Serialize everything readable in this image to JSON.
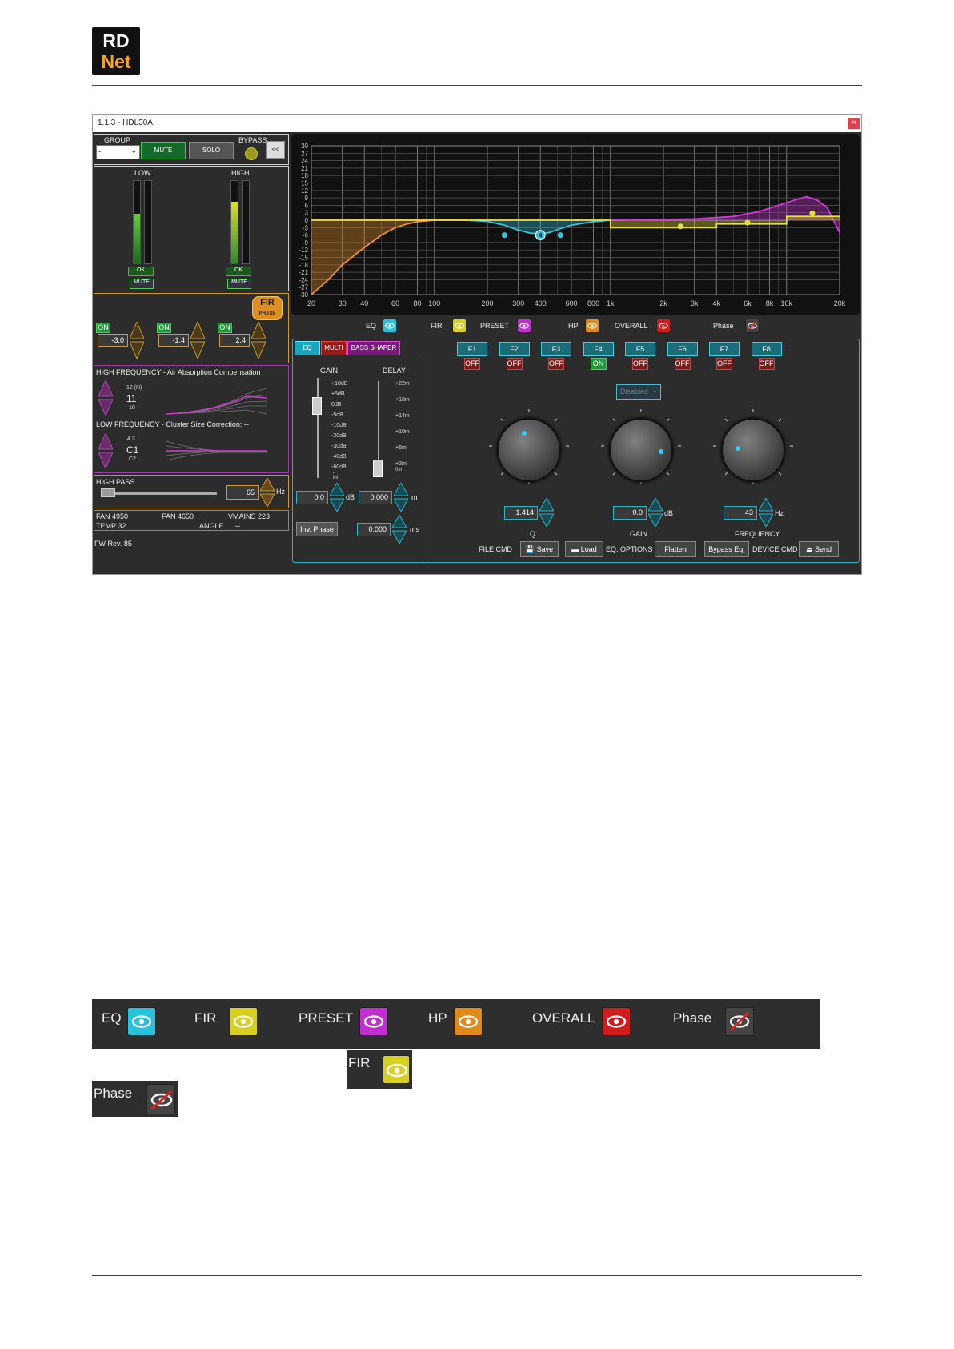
{
  "logo": {
    "line1": "RD",
    "line2": "Net"
  },
  "window": {
    "title": "1.1.3 - HDL30A",
    "close": "×"
  },
  "top": {
    "group_label": "GROUP",
    "group_value": "-",
    "mute": "MUTE",
    "solo": "SOLO",
    "bypass_label": "BYPASS",
    "collapse": "<<"
  },
  "meters": {
    "low": "LOW",
    "high": "HIGH",
    "ok": "OK",
    "mute": "MUTE",
    "low_level": 0.6,
    "high_level": 0.75
  },
  "fir": {
    "badge_top": "FIR",
    "badge_bottom": "PHASE",
    "on": "ON",
    "values": [
      "-3.0",
      "-1.4",
      "2.4"
    ]
  },
  "hf": {
    "title": "HIGH FREQUENCY - Air Absorption Compensation",
    "above": "12 (H)",
    "value": "11",
    "below": "10"
  },
  "lf": {
    "title": "LOW FREQUENCY -  Cluster Size Correction:  --",
    "above": "4.3",
    "value": "C1",
    "below": "C2"
  },
  "hp": {
    "title": "HIGH PASS",
    "value": "65",
    "unit": "Hz"
  },
  "status": {
    "fan1": "FAN 4950",
    "fan2": "FAN 4650",
    "vmains": "VMAINS 223",
    "temp": "TEMP 32",
    "angle": "ANGLE",
    "angle_val": "--",
    "fw": "FW Rev. 85"
  },
  "chart_data": {
    "type": "line",
    "x_ticks": [
      "20",
      "30",
      "40",
      "60",
      "80",
      "100",
      "200",
      "300",
      "400",
      "600",
      "800",
      "1k",
      "2k",
      "3k",
      "4k",
      "6k",
      "8k",
      "10k",
      "20k"
    ],
    "y_ticks": [
      "30",
      "27",
      "24",
      "21",
      "18",
      "15",
      "12",
      "9",
      "6",
      "3",
      "0",
      "-3",
      "-6",
      "-9",
      "-12",
      "-15",
      "-18",
      "-21",
      "-24",
      "-27",
      "-30"
    ],
    "xlim": [
      20,
      20000
    ],
    "ylim": [
      -30,
      30
    ],
    "xscale": "log",
    "grid": true,
    "series": [
      {
        "color": "#f0952a",
        "x": [
          20,
          25,
          30,
          40,
          50,
          60,
          70,
          80,
          100,
          150
        ],
        "y": [
          -30,
          -24,
          -18,
          -11,
          -6,
          -3,
          -1.5,
          -0.6,
          0,
          0
        ]
      },
      {
        "color": "#34c6d8",
        "x": [
          20,
          150,
          200,
          250,
          300,
          350,
          400,
          450,
          500,
          600,
          800,
          1000
        ],
        "y": [
          0,
          0,
          -0.5,
          -2,
          -4,
          -5.2,
          -5.5,
          -5,
          -3.8,
          -2,
          -0.6,
          0
        ]
      },
      {
        "color": "#d13ad8",
        "x": [
          20,
          1000,
          3000,
          5000,
          7000,
          9000,
          11000,
          13000,
          15000,
          17000,
          20000
        ],
        "y": [
          0,
          0,
          0.5,
          1.5,
          3.5,
          6,
          8,
          9.5,
          8,
          5,
          -5
        ]
      },
      {
        "color": "#e6e038",
        "x": [
          20,
          1000,
          1001,
          4000,
          4001,
          10000,
          10001,
          20000
        ],
        "y": [
          0,
          0,
          -3,
          -3,
          -1.5,
          -1.5,
          1.5,
          1.5
        ]
      }
    ],
    "points": [
      {
        "x": 250,
        "y": -6,
        "color": "#34c6d8"
      },
      {
        "x": 400,
        "y": -6,
        "color": "#34c6d8",
        "label": "4"
      },
      {
        "x": 520,
        "y": -6,
        "color": "#34c6d8"
      },
      {
        "x": 2500,
        "y": -2.5,
        "color": "#e6e038"
      },
      {
        "x": 6000,
        "y": -1.0,
        "color": "#e6e038"
      },
      {
        "x": 14000,
        "y": 2.8,
        "color": "#e6e038"
      }
    ]
  },
  "legend": {
    "items": [
      {
        "label": "EQ",
        "color": "#29c2de"
      },
      {
        "label": "FIR",
        "color": "#d8d020"
      },
      {
        "label": "PRESET",
        "color": "#c22fd0"
      },
      {
        "label": "HP",
        "color": "#e08a1a"
      },
      {
        "label": "OVERALL",
        "color": "#d01c1c"
      },
      {
        "label": "Phase",
        "color": "#444444"
      }
    ]
  },
  "eqtabs": {
    "eq": "EQ",
    "multi": "MULTI",
    "bass": "BASS SHAPER"
  },
  "gd": {
    "gain": "GAIN",
    "delay": "DELAY",
    "gain_scale": [
      "+10dB",
      "+5dB",
      "0dB",
      "-5dB",
      "-10dB",
      "-20dB",
      "-30dB",
      "-40dB",
      "-60dB"
    ],
    "gain_scale_last": "-inf",
    "delay_scale": [
      "+22m",
      "+18m",
      "+14m",
      "+10m",
      "+6m",
      "+2m"
    ],
    "delay_scale_last": "0m",
    "gain_value": "0.0",
    "gain_unit": "dB",
    "delay_value": "0.000",
    "delay_unit": "m",
    "inv_phase": "Inv. Phase",
    "ms_value": "0.000",
    "ms_unit": "ms"
  },
  "filters": {
    "labels": [
      "F1",
      "F2",
      "F3",
      "F4",
      "F5",
      "F6",
      "F7",
      "F8"
    ],
    "states": [
      "OFF",
      "OFF",
      "OFF",
      "ON",
      "OFF",
      "OFF",
      "OFF",
      "OFF"
    ]
  },
  "filtertype": "Disabled",
  "knobs": {
    "q_value": "1.414",
    "q_label": "Q",
    "gain_value": "0.0",
    "gain_unit": "dB",
    "gain_label": "GAIN",
    "freq_value": "43",
    "freq_unit": "Hz",
    "freq_label": "FREQUENCY"
  },
  "bottom": {
    "file_cmd": "FILE CMD",
    "save": "Save",
    "load": "Load",
    "eq_options": "EQ. OPTIONS",
    "flatten": "Flatten",
    "bypass_eq": "Bypass Eq.",
    "device_cmd": "DEVICE CMD",
    "send": "Send"
  },
  "strip": {
    "items": [
      "EQ",
      "FIR",
      "PRESET",
      "HP",
      "OVERALL",
      "Phase"
    ]
  },
  "single1": "FIR",
  "single2": "Phase"
}
